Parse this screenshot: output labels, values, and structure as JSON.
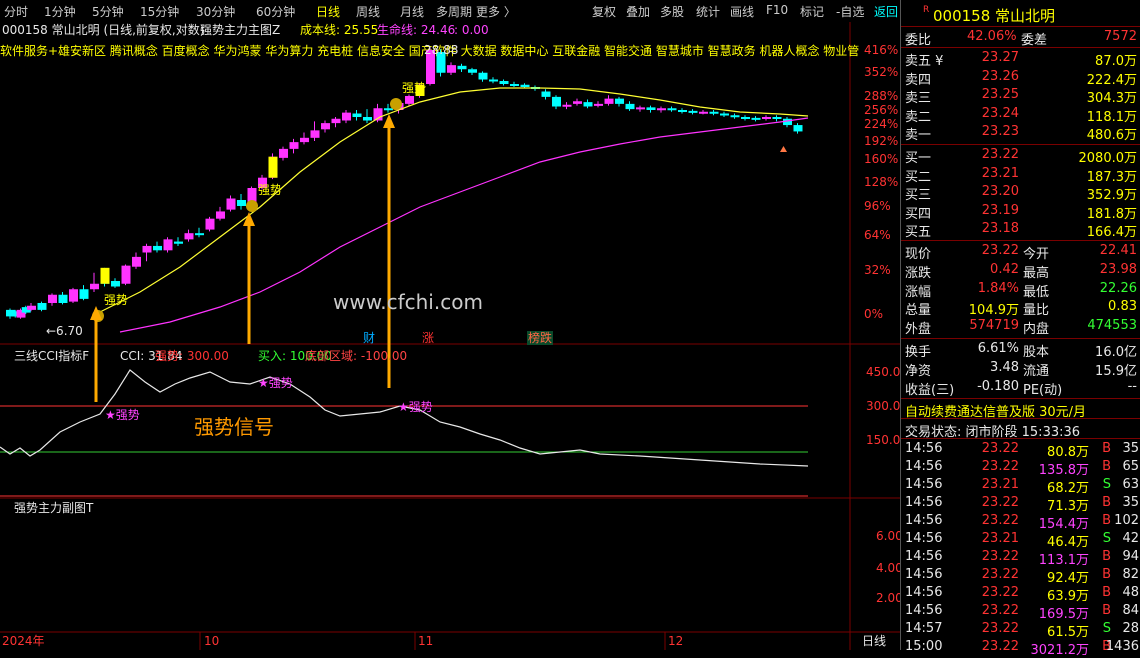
{
  "toolbar": {
    "tabs": [
      "分时",
      "1分钟",
      "5分钟",
      "15分钟",
      "30分钟",
      "60分钟",
      "日线",
      "周线",
      "月线",
      "多周期",
      "更多 〉"
    ],
    "active_tab": "日线",
    "right_buttons": [
      "复权",
      "叠加",
      "多股",
      "统计",
      "画线",
      "F10",
      "标记",
      "-自选",
      "返回"
    ]
  },
  "main_chart": {
    "header_stock": "000158 常山北明 (日线,前复权,对数)",
    "indicator_name": "强势主力主图Z",
    "cost_line_label": "成本线: 25.55",
    "life_line_label": "生命线: 24.46",
    "extra_value": ": 0.00",
    "concepts": "软件服务+雄安新区  腾讯概念  百度概念  华为鸿蒙  华为算力  充电桩  信息安全  国产软件  大数据  数据中心  互联金融  智能交通  智慧城市  智慧政务  机器人概念  物业管",
    "price_high_label": "28.88",
    "price_low_label": "←6.70",
    "y_axis": [
      "416%",
      "352%",
      "288%",
      "256%",
      "224%",
      "192%",
      "160%",
      "128%",
      "96%",
      "64%",
      "32%",
      "0%"
    ],
    "signals": [
      "强势",
      "强势",
      "强势",
      "强势"
    ],
    "events": [
      "财",
      "涨",
      "榜跌"
    ],
    "watermark": "www.cfchi.com"
  },
  "cci_panel": {
    "name": "三线CCI指标F",
    "cci_label": "CCI: 31.84",
    "strong_label": "强势: 300.00",
    "buy_label": "买入: 100.00",
    "bottom_label": "底部区域: -100.00",
    "y_axis": [
      "450.0",
      "300.0",
      "150.0"
    ],
    "signal_text": "强势信号",
    "signal_labels": [
      "强势",
      "强势",
      "强势"
    ]
  },
  "sub_panel": {
    "name": "强势主力副图T",
    "y_axis": [
      "6.00",
      "4.00",
      "2.00"
    ]
  },
  "time_axis": {
    "labels": [
      "2024年",
      "10",
      "11",
      "12"
    ],
    "period_button": "日线"
  },
  "quote": {
    "code": "000158",
    "name": "常山北明",
    "badge": "R",
    "weibi_label": "委比",
    "weibi": "42.06%",
    "weicha_label": "委差",
    "weicha": "7572",
    "sells": [
      {
        "label": "卖五 ¥",
        "price": "23.27",
        "vol": "87.0万"
      },
      {
        "label": "卖四",
        "price": "23.26",
        "vol": "222.4万"
      },
      {
        "label": "卖三",
        "price": "23.25",
        "vol": "304.3万"
      },
      {
        "label": "卖二",
        "price": "23.24",
        "vol": "118.1万"
      },
      {
        "label": "卖一",
        "price": "23.23",
        "vol": "480.6万"
      }
    ],
    "buys": [
      {
        "label": "买一",
        "price": "23.22",
        "vol": "2080.0万"
      },
      {
        "label": "买二",
        "price": "23.21",
        "vol": "187.3万"
      },
      {
        "label": "买三",
        "price": "23.20",
        "vol": "352.9万"
      },
      {
        "label": "买四",
        "price": "23.19",
        "vol": "181.8万"
      },
      {
        "label": "买五",
        "price": "23.18",
        "vol": "166.4万"
      }
    ],
    "stats": [
      {
        "l1": "现价",
        "v1": "23.22",
        "l2": "今开",
        "v2": "22.41"
      },
      {
        "l1": "涨跌",
        "v1": "0.42",
        "l2": "最高",
        "v2": "23.98"
      },
      {
        "l1": "涨幅",
        "v1": "1.84%",
        "l2": "最低",
        "v2": "22.26"
      },
      {
        "l1": "总量",
        "v1": "104.9万",
        "l2": "量比",
        "v2": "0.83"
      },
      {
        "l1": "外盘",
        "v1": "574719",
        "l2": "内盘",
        "v2": "474553"
      }
    ],
    "stats2": [
      {
        "l1": "换手",
        "v1": "6.61%",
        "l2": "股本",
        "v2": "16.0亿"
      },
      {
        "l1": "净资",
        "v1": "3.48",
        "l2": "流通",
        "v2": "15.9亿"
      },
      {
        "l1": "收益(三)",
        "v1": "-0.180",
        "l2": "PE(动)",
        "v2": "--"
      }
    ],
    "ad_text": "自动续费通达信普及版  30元/月",
    "trade_status": "交易状态: 闭市阶段 15:33:36",
    "ticks": [
      {
        "t": "14:56",
        "p": "23.22",
        "v": "80.8万",
        "s": "B",
        "n": "35"
      },
      {
        "t": "14:56",
        "p": "23.22",
        "v": "135.8万",
        "s": "B",
        "n": "65"
      },
      {
        "t": "14:56",
        "p": "23.21",
        "v": "68.2万",
        "s": "S",
        "n": "63"
      },
      {
        "t": "14:56",
        "p": "23.22",
        "v": "71.3万",
        "s": "B",
        "n": "35"
      },
      {
        "t": "14:56",
        "p": "23.22",
        "v": "154.4万",
        "s": "B",
        "n": "102"
      },
      {
        "t": "14:56",
        "p": "23.21",
        "v": "46.4万",
        "s": "S",
        "n": "42"
      },
      {
        "t": "14:56",
        "p": "23.22",
        "v": "113.1万",
        "s": "B",
        "n": "94"
      },
      {
        "t": "14:56",
        "p": "23.22",
        "v": "92.4万",
        "s": "B",
        "n": "82"
      },
      {
        "t": "14:56",
        "p": "23.22",
        "v": "63.9万",
        "s": "B",
        "n": "48"
      },
      {
        "t": "14:56",
        "p": "23.22",
        "v": "169.5万",
        "s": "B",
        "n": "84"
      },
      {
        "t": "14:57",
        "p": "23.22",
        "v": "61.5万",
        "s": "S",
        "n": "28"
      },
      {
        "t": "15:00",
        "p": "23.22",
        "v": "3021.2万",
        "s": "B",
        "n": "1436"
      }
    ]
  },
  "chart_data": {
    "type": "candlestick",
    "title": "000158 常山北明 (日线,前复权,对数)",
    "y_ticks_pct": [
      0,
      32,
      64,
      96,
      128,
      160,
      192,
      224,
      256,
      288,
      352,
      416
    ],
    "candles_approx": [
      [
        0.0,
        3,
        -2,
        4,
        -4
      ],
      [
        0.5,
        2,
        -2,
        3,
        -3
      ],
      [
        1,
        -3,
        3,
        4,
        -4
      ],
      [
        1.5,
        5,
        1,
        6,
        0
      ],
      [
        2,
        3,
        6,
        8,
        2
      ],
      [
        3,
        8,
        3,
        9,
        2
      ],
      [
        4,
        8,
        14,
        15,
        6
      ],
      [
        5,
        14,
        8,
        16,
        7
      ],
      [
        6,
        9,
        18,
        19,
        8
      ],
      [
        7,
        18,
        11,
        21,
        10
      ],
      [
        8,
        18,
        22,
        30,
        16
      ],
      [
        9,
        30,
        22,
        34,
        20
      ],
      [
        10,
        24,
        20,
        26,
        19
      ],
      [
        11,
        22,
        36,
        37,
        21
      ],
      [
        12,
        35,
        44,
        48,
        33
      ],
      [
        13,
        48,
        54,
        56,
        40
      ],
      [
        14,
        54,
        50,
        58,
        48
      ],
      [
        15,
        50,
        60,
        62,
        48
      ],
      [
        16,
        58,
        56,
        62,
        54
      ],
      [
        17,
        60,
        66,
        70,
        58
      ],
      [
        18,
        66,
        64,
        72,
        62
      ],
      [
        19,
        70,
        82,
        84,
        68
      ],
      [
        20,
        82,
        90,
        95,
        80
      ],
      [
        21,
        92,
        106,
        110,
        90
      ],
      [
        22,
        104,
        96,
        112,
        92
      ],
      [
        23,
        96,
        120,
        122,
        94
      ],
      [
        24,
        120,
        134,
        138,
        118
      ],
      [
        25,
        134,
        164,
        170,
        132
      ],
      [
        26,
        162,
        178,
        182,
        158
      ],
      [
        27,
        178,
        190,
        196,
        170
      ],
      [
        28,
        190,
        198,
        208,
        186
      ],
      [
        29,
        198,
        212,
        230,
        192
      ],
      [
        30,
        214,
        226,
        232,
        208
      ],
      [
        31,
        226,
        236,
        240,
        218
      ],
      [
        32,
        232,
        250,
        256,
        226
      ],
      [
        33,
        248,
        240,
        256,
        232
      ],
      [
        34,
        240,
        232,
        258,
        226
      ],
      [
        35,
        232,
        260,
        270,
        228
      ],
      [
        36,
        260,
        256,
        270,
        250
      ],
      [
        37,
        256,
        272,
        280,
        248
      ],
      [
        38,
        270,
        288,
        292,
        264
      ],
      [
        39,
        288,
        318,
        322,
        284
      ],
      [
        40,
        320,
        416,
        424,
        316
      ],
      [
        41,
        410,
        350,
        418,
        340
      ],
      [
        42,
        350,
        372,
        380,
        344
      ],
      [
        43,
        370,
        360,
        376,
        352
      ],
      [
        44,
        360,
        350,
        364,
        344
      ],
      [
        45,
        350,
        332,
        354,
        326
      ],
      [
        46,
        332,
        328,
        338,
        322
      ],
      [
        47,
        328,
        320,
        332,
        316
      ],
      [
        48,
        320,
        318,
        326,
        312
      ],
      [
        49,
        318,
        312,
        322,
        308
      ],
      [
        50,
        312,
        308,
        316,
        302
      ],
      [
        51,
        300,
        286,
        306,
        280
      ],
      [
        52,
        286,
        264,
        290,
        258
      ],
      [
        53,
        264,
        268,
        274,
        258
      ],
      [
        54,
        270,
        276,
        282,
        266
      ],
      [
        55,
        274,
        264,
        280,
        260
      ],
      [
        56,
        266,
        270,
        276,
        262
      ],
      [
        57,
        270,
        282,
        290,
        266
      ],
      [
        58,
        282,
        270,
        286,
        264
      ],
      [
        59,
        270,
        258,
        276,
        254
      ],
      [
        60,
        258,
        262,
        266,
        252
      ],
      [
        61,
        262,
        256,
        266,
        250
      ],
      [
        62,
        256,
        260,
        264,
        250
      ],
      [
        63,
        260,
        256,
        264,
        252
      ],
      [
        64,
        256,
        254,
        260,
        248
      ],
      [
        65,
        254,
        250,
        258,
        246
      ],
      [
        66,
        250,
        252,
        256,
        246
      ],
      [
        67,
        252,
        248,
        256,
        244
      ],
      [
        68,
        248,
        244,
        252,
        240
      ],
      [
        69,
        244,
        240,
        248,
        236
      ],
      [
        70,
        240,
        238,
        244,
        232
      ],
      [
        71,
        238,
        236,
        242,
        230
      ],
      [
        72,
        236,
        240,
        244,
        232
      ],
      [
        73,
        240,
        236,
        244,
        230
      ],
      [
        74,
        236,
        222,
        240,
        218
      ],
      [
        75,
        222,
        210,
        226,
        206
      ]
    ]
  }
}
